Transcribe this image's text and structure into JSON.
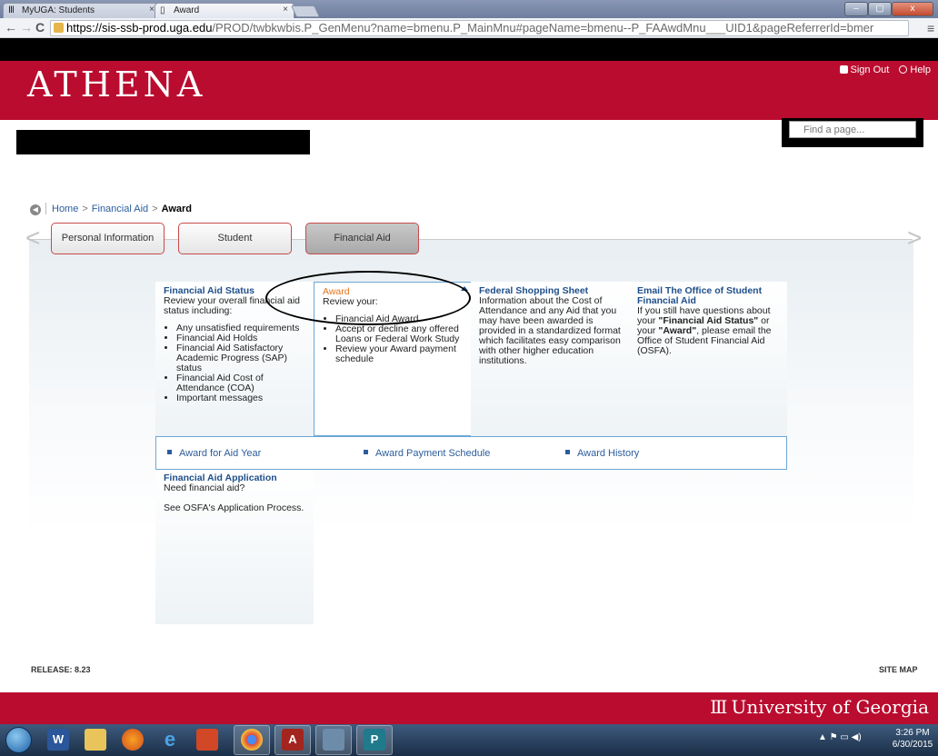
{
  "browser": {
    "tabs": [
      {
        "title": "MyUGA: Students",
        "close": "×"
      },
      {
        "title": "Award",
        "close": "×"
      }
    ],
    "url_host": "https://sis-ssb-prod.uga.edu",
    "url_path": "/PROD/twbkwbis.P_GenMenu?name=bmenu.P_MainMnu#pageName=bmenu--P_FAAwdMnu___UID1&pageReferrerId=bmer",
    "back": "←",
    "forward": "→",
    "reload": "C",
    "menu": "≡",
    "minimize": "–",
    "maximize": "▢",
    "close": "x"
  },
  "header": {
    "logo": "ATHENA",
    "sign_out": "Sign Out",
    "help": "Help",
    "find_placeholder": "Find a page..."
  },
  "breadcrumb": {
    "home": "Home",
    "sep1": ">",
    "financial_aid": "Financial Aid",
    "sep2": ">",
    "current": "Award"
  },
  "tabs": {
    "personal": "Personal Information",
    "student": "Student",
    "financial": "Financial Aid"
  },
  "cards": {
    "status": {
      "title": "Financial Aid Status",
      "desc": "Review your overall financial aid status including:",
      "items": [
        "Any unsatisfied requirements",
        "Financial Aid Holds",
        "Financial Aid Satisfactory Academic Progress (SAP) status",
        "Financial Aid Cost of Attendance (COA)",
        "Important messages"
      ]
    },
    "award": {
      "title": "Award",
      "desc": "Review your:",
      "items": [
        "Financial Aid Award",
        "Accept or decline any offered Loans or Federal Work Study",
        "Review your Award payment schedule"
      ]
    },
    "shopping": {
      "title": "Federal Shopping Sheet",
      "desc": "Information about the Cost of Attendance and any Aid that you may have been awarded is provided in a standardized format which facilitates easy comparison with other higher education institutions."
    },
    "email": {
      "title": "Email The Office of Student Financial Aid",
      "desc_pre": "If you still have questions about your ",
      "desc_b1": "\"Financial Aid Status\"",
      "desc_mid": " or your ",
      "desc_b2": "\"Award\"",
      "desc_post": ", please email the Office of Student Financial Aid (OSFA)."
    },
    "app": {
      "title": "Financial Aid Application",
      "desc": "Need financial aid?",
      "link": "See OSFA's Application Process."
    }
  },
  "submenu": [
    "Award for Aid Year",
    "Award Payment Schedule",
    "Award History"
  ],
  "footer": {
    "release": "RELEASE: 8.23",
    "sitemap": "SITE MAP",
    "uga": "University of Georgia"
  },
  "taskbar": {
    "time": "3:26 PM",
    "date": "6/30/2015"
  }
}
